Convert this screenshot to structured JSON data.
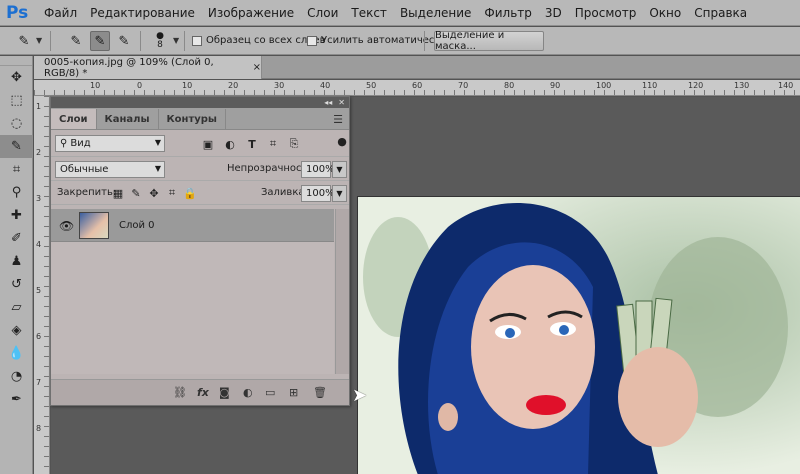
{
  "app": {
    "logo": "Ps"
  },
  "menu": [
    "Файл",
    "Редактирование",
    "Изображение",
    "Слои",
    "Текст",
    "Выделение",
    "Фильтр",
    "3D",
    "Просмотр",
    "Окно",
    "Справка"
  ],
  "options": {
    "brush_size": "8",
    "sample_all_layers": "Образец со всех слоев",
    "auto_enhance": "Усилить автоматически",
    "select_mask_button": "Выделение и маска..."
  },
  "document": {
    "tab_title": "0005-копия.jpg @ 109% (Слой 0, RGB/8) *",
    "close": "×"
  },
  "rulers": {
    "h": [
      "10",
      "0",
      "10",
      "20",
      "30",
      "40",
      "50",
      "60",
      "70",
      "80",
      "90",
      "100",
      "110",
      "120",
      "130",
      "140"
    ],
    "v": [
      "1",
      "2",
      "3",
      "4",
      "5",
      "6",
      "7",
      "8"
    ]
  },
  "layers_panel": {
    "tabs": [
      "Слои",
      "Каналы",
      "Контуры"
    ],
    "filter_kind": "Вид",
    "blend_mode": "Обычные",
    "opacity_label": "Непрозрачность:",
    "opacity_value": "100%",
    "lock_label": "Закрепить:",
    "fill_label": "Заливка:",
    "fill_value": "100%",
    "layers": [
      {
        "name": "Слой 0",
        "visible": true
      }
    ]
  },
  "colors": {
    "accent": "#1c6fd1",
    "panel_bg": "#bcb4b4",
    "selected_layer": "#9a9a9a"
  }
}
